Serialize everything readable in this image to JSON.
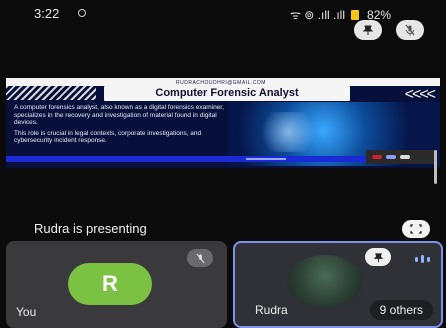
{
  "status": {
    "time": "3:22",
    "signal_text": "ᯤ ⊚ .ıll .ıll",
    "battery": "82%",
    "battery_color": "#f5c518"
  },
  "top_actions": {
    "pin_icon": "pin-icon",
    "mic_off_icon": "mic-off-icon"
  },
  "presentation": {
    "email": "RUDRACHOUDHRI@GMAIL.COM",
    "title": "Computer Forensic Analyst",
    "arrows": "<<<<",
    "bullet_1": "A computer forensics analyst, also known as a digital forensics examiner, specializes in the recovery and investigation of material found in digital devices.",
    "bullet_2": "This role is crucial in legal contexts, corporate investigations, and cybersecurity incident response."
  },
  "presenter": {
    "text": "Rudra is presenting"
  },
  "tiles": {
    "you": {
      "initial": "R",
      "label": "You",
      "avatar_color": "#7cc242"
    },
    "rudra": {
      "label": "Rudra",
      "others": "9 others",
      "border_color": "#7f93e6"
    }
  }
}
